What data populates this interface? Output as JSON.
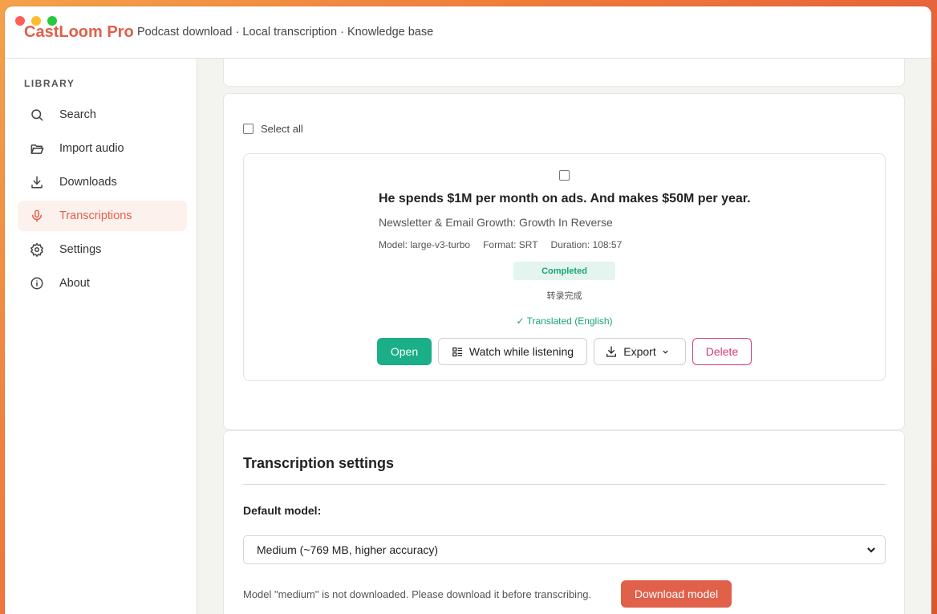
{
  "app": {
    "title": "CastLoom Pro",
    "tagline": "Podcast download · Local transcription · Knowledge base",
    "accent_color": "#e0604a"
  },
  "sidebar": {
    "heading": "LIBRARY",
    "items": [
      {
        "label": "Search",
        "icon": "search-icon"
      },
      {
        "label": "Import audio",
        "icon": "folder-open-icon"
      },
      {
        "label": "Downloads",
        "icon": "download-icon"
      },
      {
        "label": "Transcriptions",
        "icon": "microphone-icon",
        "active": true
      },
      {
        "label": "Settings",
        "icon": "gear-icon"
      },
      {
        "label": "About",
        "icon": "info-icon"
      }
    ]
  },
  "list": {
    "select_all_label": "Select all",
    "items": [
      {
        "title": "He spends $1M per month on ads. And makes $50M per year.",
        "subtitle": "Newsletter & Email Growth: Growth In Reverse",
        "model": "Model: large-v3-turbo",
        "format": "Format: SRT",
        "duration": "Duration: 108:57",
        "status": "Completed",
        "status_note": "转录完成",
        "translated": "✓ Translated (English)",
        "actions": {
          "open": "Open",
          "watch": "Watch while listening",
          "export": "Export",
          "delete": "Delete"
        }
      }
    ]
  },
  "transcription_settings": {
    "title": "Transcription settings",
    "default_model_label": "Default model:",
    "default_model_value": "Medium (~769 MB, higher accuracy)",
    "warning": "Model \"medium\" is not downloaded. Please download it before transcribing.",
    "download_button": "Download model"
  }
}
